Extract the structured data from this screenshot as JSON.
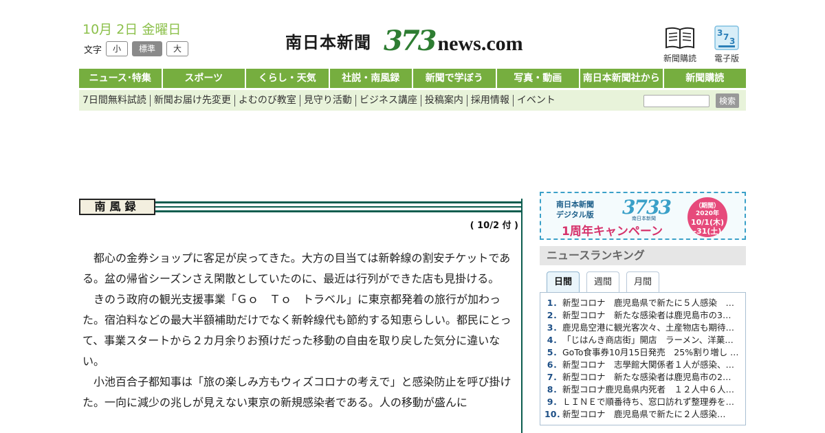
{
  "header": {
    "date": "10月 2日 金曜日",
    "font_size_label": "文字",
    "font_sizes": [
      "小",
      "標準",
      "大"
    ],
    "logo_jp": "南日本新聞",
    "logo_num": "373",
    "logo_domain": "news.com",
    "icons": [
      {
        "label": "新聞購読",
        "icon": "newspaper-icon"
      },
      {
        "label": "電子版",
        "icon": "digital-edition-icon"
      }
    ]
  },
  "nav": {
    "items": [
      "ニュース･特集",
      "スポーツ",
      "くらし・天気",
      "社説・南風録",
      "新聞で学ぼう",
      "写真・動画",
      "南日本新聞社から",
      "新聞購読"
    ]
  },
  "subnav": {
    "items": [
      "7日間無料試読",
      "新聞お届け先変更",
      "よむのび教室",
      "見守り活動",
      "ビジネス講座",
      "投稿案内",
      "採用情報",
      "イベント"
    ],
    "search_button": "検索"
  },
  "column": {
    "title": "南風録",
    "date": "( 10/2 付 )",
    "paragraphs": [
      "都心の金券ショップに客足が戻ってきた。大方の目当ては新幹線の割安チケットである。盆の帰省シーズンさえ閑散としていたのに、最近は行列ができた店も見掛ける。",
      "きのう政府の観光支援事業「Ｇｏ　Ｔｏ　トラベル」に東京都発着の旅行が加わった。宿泊料などの最大半額補助だけでなく新幹線代も節約する知恵らしい。都民にとって、事業スタートから２カ月余りお預けだった移動の自由を取り戻した気分に違いない。",
      "小池百合子都知事は「旅の楽しみ方もウィズコロナの考えで」と感染防止を呼び掛けた。一向に減少の兆しが見えない東京の新規感染者である。人の移動が盛んに"
    ]
  },
  "banner": {
    "line1": "南日本新聞",
    "line2": "デジタル版",
    "num": "3733",
    "sub": "南日本新聞",
    "campaign": "1周年キャンペーン",
    "circle_top": "（期間）",
    "circle_year": "2020年",
    "circle_start": "10/1(木)",
    "circle_end": "-31(土)"
  },
  "ranking": {
    "heading": "ニュースランキング",
    "tabs": [
      "日間",
      "週間",
      "月間"
    ],
    "items": [
      {
        "num": "1．",
        "title": "新型コロナ　鹿児島県で新たに５人感染　…"
      },
      {
        "num": "2．",
        "title": "新型コロナ　新たな感染者は鹿児島市の3…"
      },
      {
        "num": "3．",
        "title": "鹿児島空港に観光客次々、土産物店も期待…"
      },
      {
        "num": "4．",
        "title": "「じはんき商店街」開店　ラーメン、洋菓…"
      },
      {
        "num": "5．",
        "title": "GoTo食事券10月15日発売　25%割り増し …"
      },
      {
        "num": "6．",
        "title": "新型コロナ　志學館大関係者１人が感染、…"
      },
      {
        "num": "7．",
        "title": "新型コロナ　新たな感染者は鹿児島市の2…"
      },
      {
        "num": "8．",
        "title": "新型コロナ鹿児島県内死者　１２人中６人…"
      },
      {
        "num": "9．",
        "title": "ＬＩＮＥで順番待ち、窓口訪れず整理券を…"
      },
      {
        "num": "10．",
        "title": "新型コロナ　鹿児島県で新たに２人感染…"
      }
    ]
  }
}
